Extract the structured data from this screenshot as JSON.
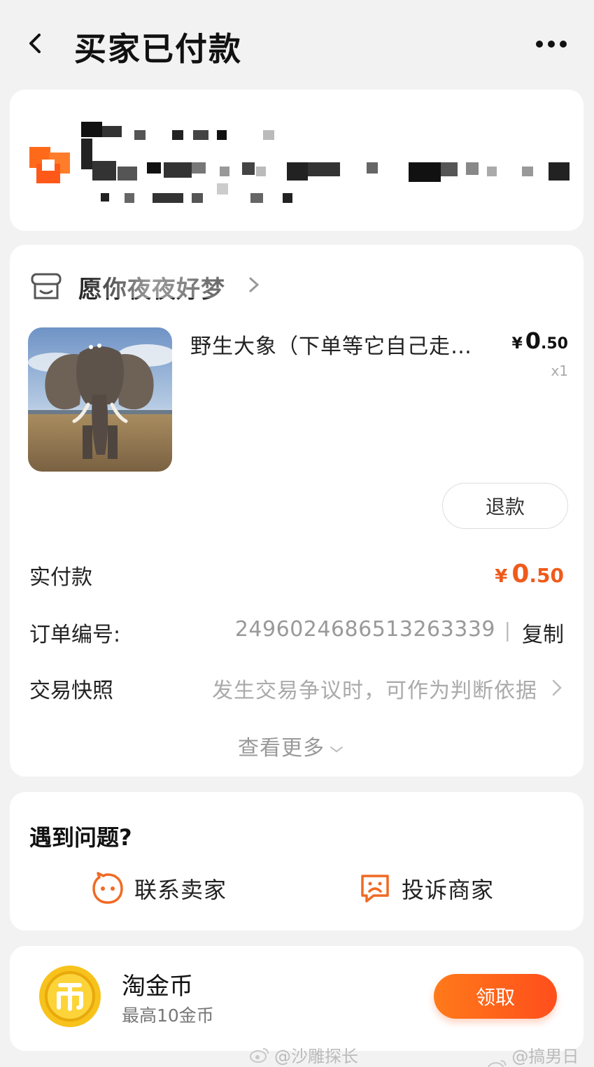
{
  "header": {
    "title": "买家已付款"
  },
  "order": {
    "shop_name": "愿你夜夜好梦",
    "product_title": "野生大象（下单等它自己走…",
    "price_currency": "¥",
    "price_int": "0",
    "price_dec": ".50",
    "quantity": "x1",
    "refund_label": "退款",
    "paid_label": "实付款",
    "paid_currency": "¥",
    "paid_int": "0",
    "paid_dec": ".50",
    "order_no_label": "订单编号:",
    "order_no": "2496024686513263339",
    "order_sep": "|",
    "copy_label": "复制",
    "snapshot_label": "交易快照",
    "snapshot_hint": "发生交易争议时，可作为判断依据",
    "view_more": "查看更多"
  },
  "help": {
    "title": "遇到问题?",
    "contact_seller": "联系卖家",
    "complain": "投诉商家"
  },
  "coin": {
    "title": "淘金币",
    "subtitle": "最高10金币",
    "claim_label": "领取"
  },
  "watermarks": [
    "@沙雕探长",
    "@搞男日记"
  ],
  "colors": {
    "accent": "#ff5a1f",
    "price": "#f05a1a",
    "background": "#f2f2f2"
  }
}
